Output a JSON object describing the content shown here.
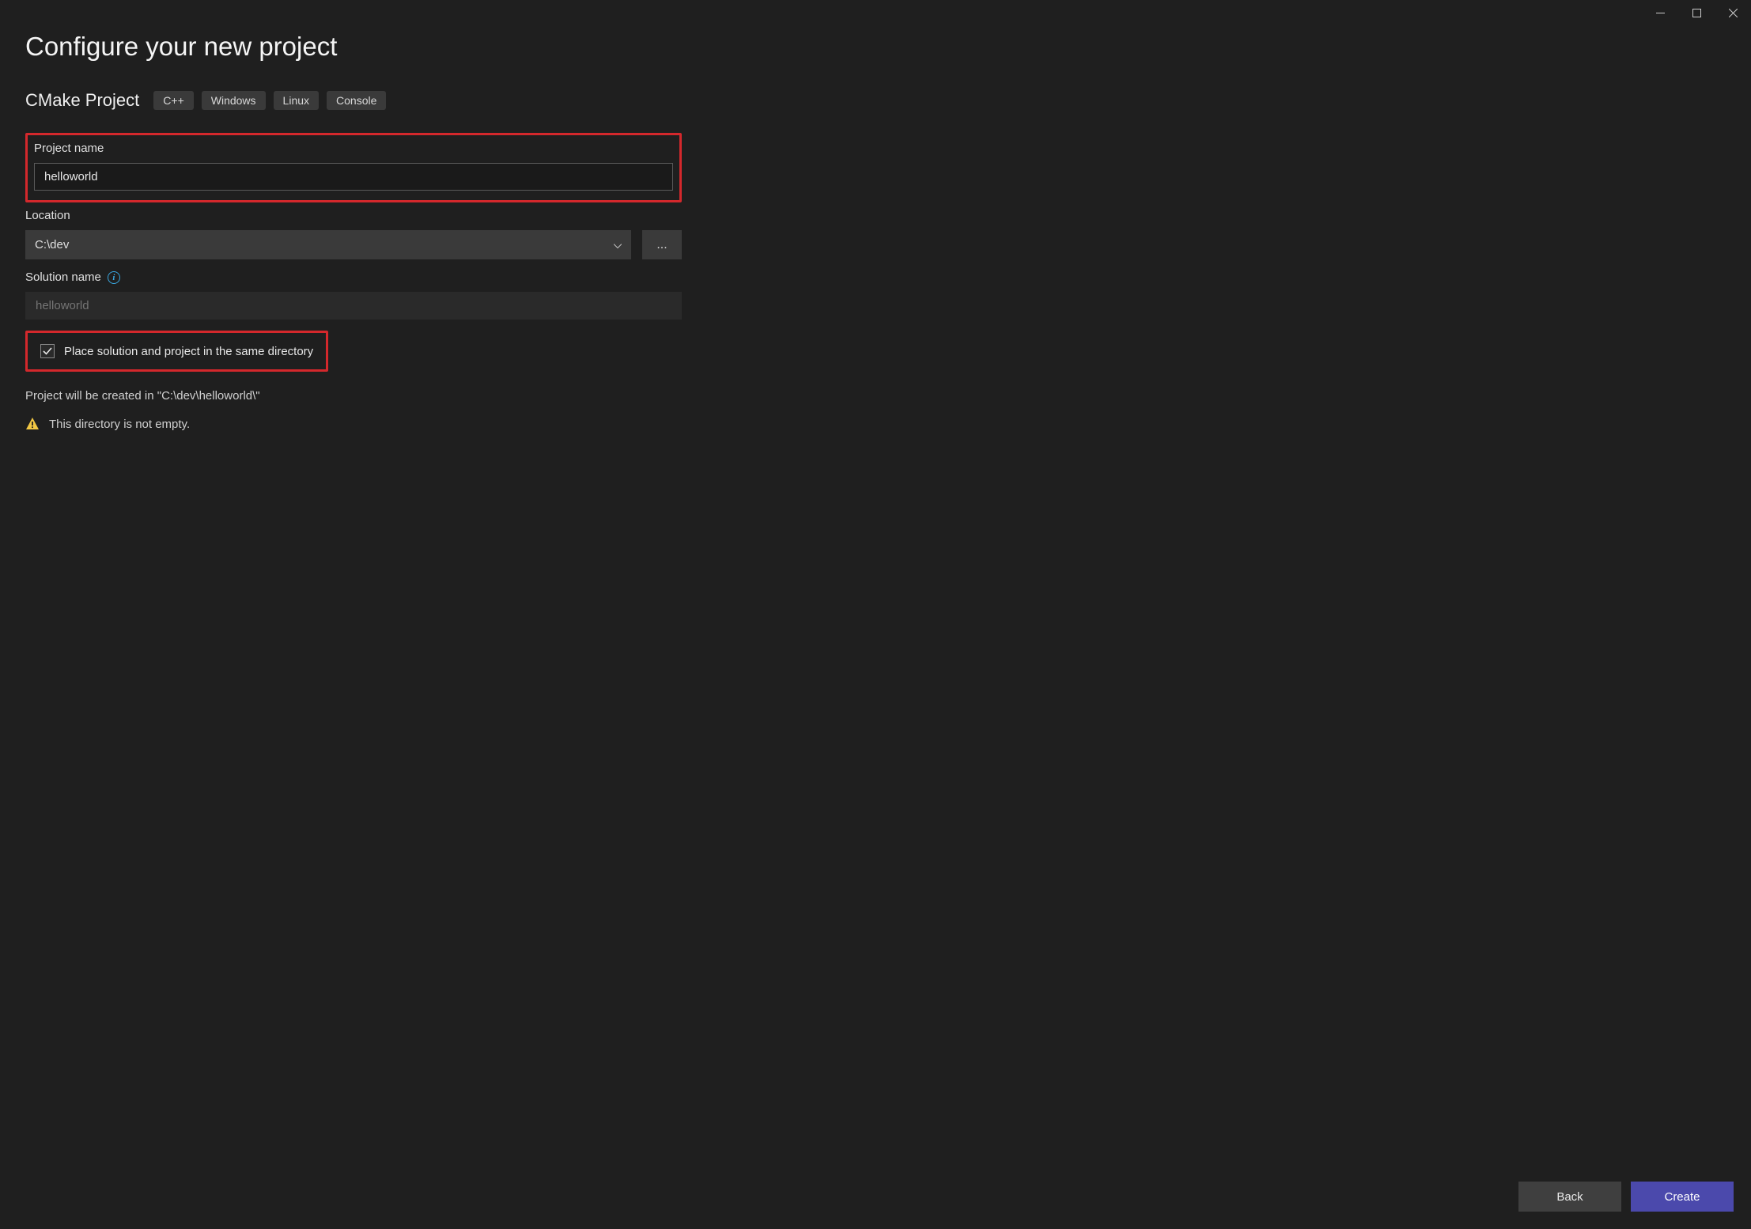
{
  "page_title": "Configure your new project",
  "template": {
    "name": "CMake Project",
    "tags": [
      "C++",
      "Windows",
      "Linux",
      "Console"
    ]
  },
  "fields": {
    "project_name": {
      "label": "Project name",
      "value": "helloworld"
    },
    "location": {
      "label": "Location",
      "value": "C:\\dev",
      "browse_label": "..."
    },
    "solution_name": {
      "label": "Solution name",
      "placeholder": "helloworld"
    },
    "same_dir_checkbox": {
      "label": "Place solution and project in the same directory",
      "checked": true
    }
  },
  "summary_text": "Project will be created in \"C:\\dev\\helloworld\\\"",
  "warning_text": "This directory is not empty.",
  "footer": {
    "back": "Back",
    "create": "Create"
  }
}
